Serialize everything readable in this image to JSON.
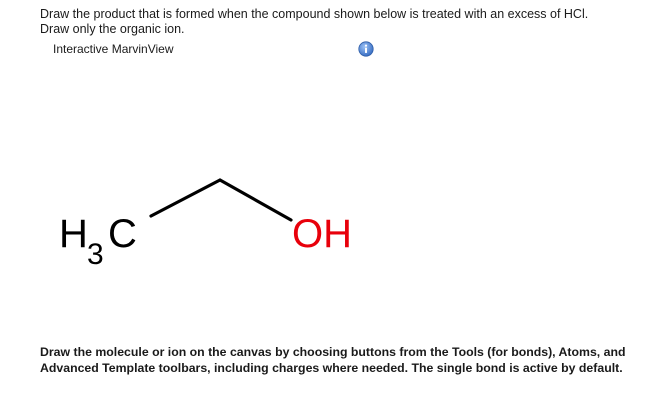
{
  "question": {
    "line1": "Draw the product that is formed when the compound shown below is treated with an excess of HCl.",
    "line2": "Draw only the organic ion."
  },
  "viewer": {
    "label": "Interactive MarvinView",
    "info_icon": "info-icon",
    "info_color": "#4a7fd0"
  },
  "molecule": {
    "left_group": "H",
    "left_subscript": "3",
    "left_atom": "C",
    "right_group": "OH",
    "right_group_color": "#e8000b",
    "bond_color": "#000000"
  },
  "instructions": {
    "text": "Draw the molecule or ion on the canvas by choosing buttons from the Tools (for bonds), Atoms, and Advanced Template toolbars, including charges where needed. The single bond is active by default."
  }
}
